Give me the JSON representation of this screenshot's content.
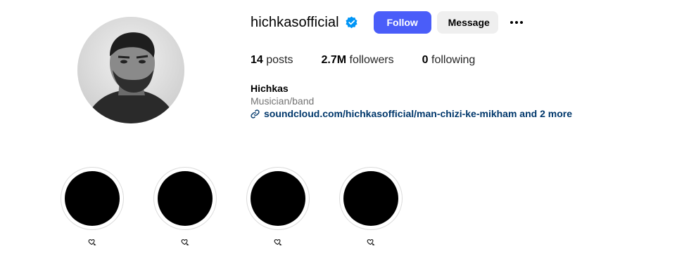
{
  "profile": {
    "username": "hichkasofficial",
    "verified": true,
    "follow_label": "Follow",
    "message_label": "Message",
    "avatar_icon": "profile-photo"
  },
  "stats": {
    "posts_count": "14",
    "posts_label": "posts",
    "followers_count": "2.7M",
    "followers_label": "followers",
    "following_count": "0",
    "following_label": "following"
  },
  "bio": {
    "name": "Hichkas",
    "category": "Musician/band",
    "link": "soundcloud.com/hichkasofficial/man-chizi-ke-mikham and 2 more"
  },
  "highlights": [
    {
      "label_icon": "dove-heart-emoji"
    },
    {
      "label_icon": "dove-heart-emoji"
    },
    {
      "label_icon": "dove-heart-emoji"
    },
    {
      "label_icon": "dove-heart-emoji"
    }
  ],
  "colors": {
    "follow_button": "#4a5df9",
    "message_button": "#efefef",
    "link": "#00376b",
    "verified_badge": "#0095f6",
    "secondary_text": "#737373"
  }
}
